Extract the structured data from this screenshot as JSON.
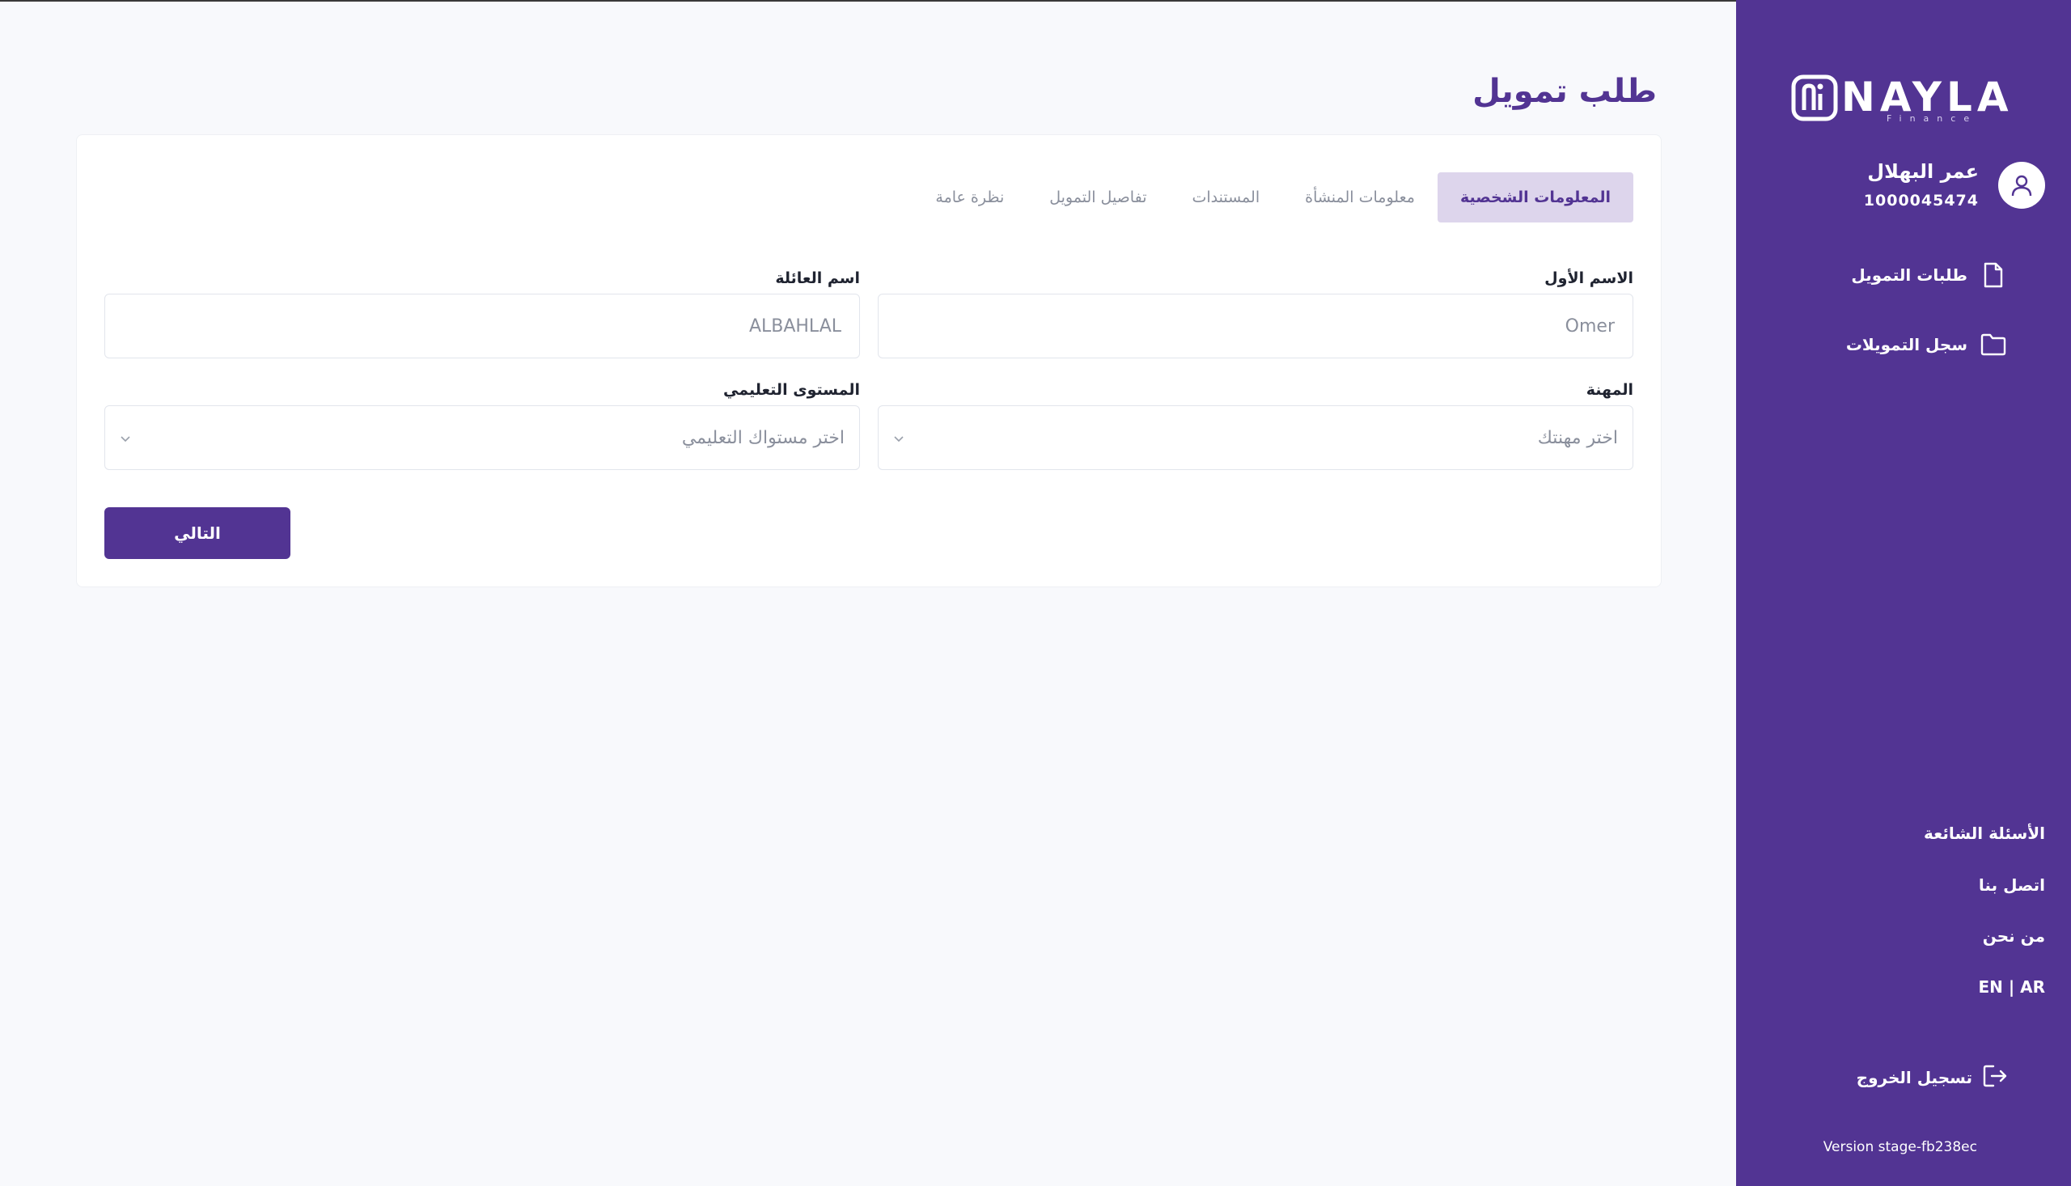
{
  "page_title": "طلب تمويل",
  "sidebar": {
    "logo_text": "NAYLA",
    "logo_sub": "Finance",
    "user_name": "عمر البهلال",
    "user_id": "1000045474",
    "nav": [
      {
        "label": "طلبات التمويل",
        "icon": "file-icon"
      },
      {
        "label": "سجل التمويلات",
        "icon": "folder-icon"
      }
    ],
    "links": [
      "الأسئلة الشائعة",
      "اتصل بنا",
      "من نحن",
      "EN | AR"
    ],
    "logout_label": "تسجيل الخروج",
    "version": "Version stage-fb238ec",
    "bg_color": "#523493"
  },
  "tabs": [
    {
      "label": "المعلومات الشخصية",
      "active": true
    },
    {
      "label": "معلومات المنشأة",
      "active": false
    },
    {
      "label": "المستندات",
      "active": false
    },
    {
      "label": "تفاصيل التمويل",
      "active": false
    },
    {
      "label": "نظرة عامة",
      "active": false
    }
  ],
  "form": {
    "first_name": {
      "label": "الاسم الأول",
      "value": "Omer"
    },
    "family_name": {
      "label": "اسم العائلة",
      "value": "ALBAHLAL"
    },
    "occupation": {
      "label": "المهنة",
      "placeholder": "اختر مهنتك"
    },
    "education": {
      "label": "المستوى التعليمي",
      "placeholder": "اختر مستواك التعليمي"
    },
    "next_label": "التالي"
  }
}
